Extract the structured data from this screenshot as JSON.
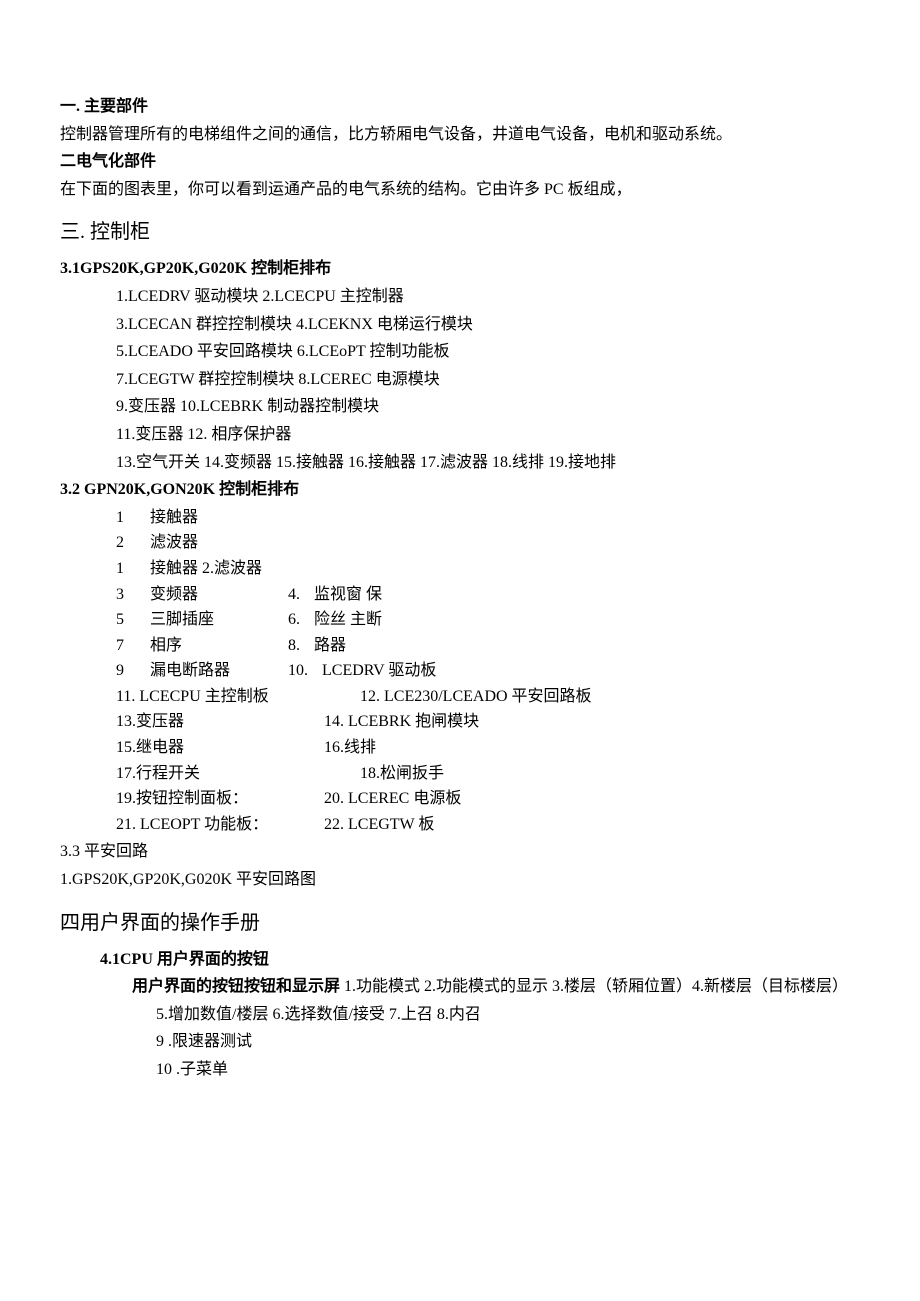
{
  "sec1": {
    "title": "一. 主要部件",
    "body": "控制器管理所有的电梯组件之间的通信，比方轿厢电气设备，井道电气设备，电机和驱动系统。"
  },
  "sec2": {
    "title": "二电气化部件",
    "body": "在下面的图表里，你可以看到运通产品的电气系统的结构。它由许多 PC 板组成，"
  },
  "sec3": {
    "title": "三. 控制柜"
  },
  "sec31": {
    "title": "3.1GPS20K,GP20K,G020K 控制柜排布",
    "lines": [
      "1.LCEDRV 驱动模块 2.LCECPU 主控制器",
      "3.LCECAN 群控控制模块 4.LCEKNX 电梯运行模块",
      "5.LCEADO 平安回路模块 6.LCEoPT 控制功能板",
      "7.LCEGTW 群控控制模块 8.LCEREC 电源模块",
      "9.变压器 10.LCEBRK 制动器控制模块",
      "11.变压器 12. 相序保护器",
      "13.空气开关 14.变频器 15.接触器 16.接触器 17.滤波器 18.线排 19.接地排"
    ]
  },
  "sec32": {
    "title": "3.2    GPN20K,GON20K 控制柜排布",
    "top_rows": [
      {
        "n": "1",
        "t": "接触器"
      },
      {
        "n": "2",
        "t": "滤波器"
      },
      {
        "n": "1",
        "t": "接触器 2.滤波器"
      }
    ],
    "pair_rows": [
      {
        "ln": "3",
        "lt": "变频器",
        "rn": "4.",
        "rt": "监视窗  保"
      },
      {
        "ln": "5",
        "lt": "三脚插座",
        "rn": "6.",
        "rt": "险丝  主断"
      },
      {
        "ln": "7",
        "lt": "相序",
        "rn": "8.",
        "rt": "路器"
      },
      {
        "ln": "9",
        "lt": "漏电断路器",
        "rn": "10.",
        "rt": "LCEDRV 驱动板"
      }
    ],
    "wide_rows": [
      {
        "l": "11. LCECPU 主控制板",
        "r": "12. LCE230/LCEADO 平安回路板"
      },
      {
        "l": "13.变压器",
        "r": "14. LCEBRK 抱闸模块"
      },
      {
        "l": "15.继电器",
        "r": "16.线排"
      },
      {
        "l": "17.行程开关",
        "r": "18.松闸扳手"
      },
      {
        "l": "19.按钮控制面板：",
        "r": "20. LCEREC 电源板"
      },
      {
        "l": "21. LCEOPT 功能板：",
        "r": "22. LCEGTW 板"
      }
    ]
  },
  "sec33": {
    "title": "3.3    平安回路",
    "line": "1.GPS20K,GP20K,G020K 平安回路图"
  },
  "sec4": {
    "title": "四用户界面的操作手册"
  },
  "sec41": {
    "title": "4.1CPU 用户界面的按钮",
    "lead": "用户界面的按钮按钮和显示屏",
    "inline": " 1.功能模式 2.功能模式的显示 3.楼层（轿厢位置）4.新楼层（目标楼层）",
    "l2": "5.增加数值/楼层 6.选择数值/接受 7.上召 8.内召",
    "l3": "9  .限速器测试",
    "l4": "10  .子菜单"
  }
}
